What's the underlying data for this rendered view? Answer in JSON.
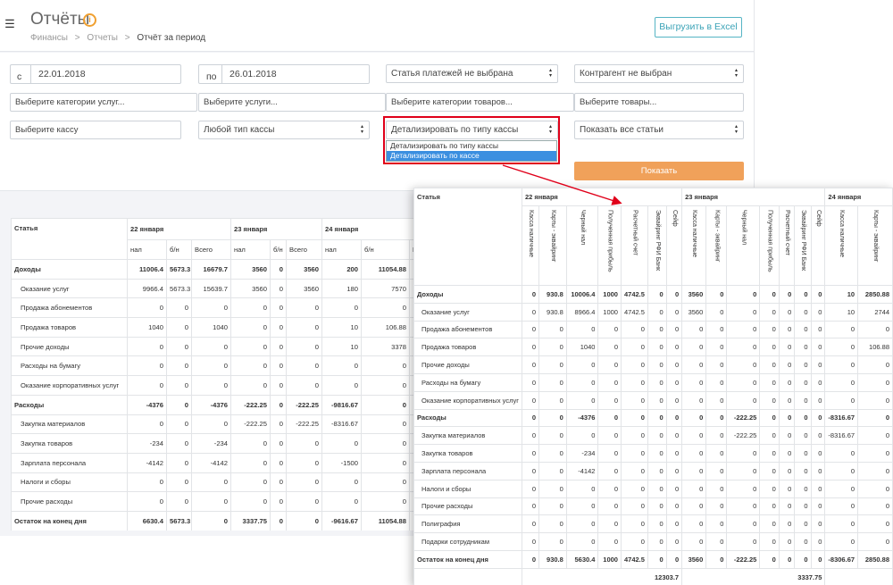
{
  "header": {
    "title": "Отчёты",
    "info_icon": "i",
    "breadcrumb": [
      "Финансы",
      ">",
      "Отчеты",
      ">",
      "Отчёт за период"
    ],
    "export_label": "Выгрузить в Excel"
  },
  "filters": {
    "from_label": "с",
    "from_value": "22.01.2018",
    "to_label": "по",
    "to_value": "26.01.2018",
    "payment_item": "Статья платежей не выбрана",
    "counterparty": "Контрагент не выбран",
    "service_categories_placeholder": "Выберите категории услуг...",
    "services_placeholder": "Выберите услуги...",
    "product_categories_placeholder": "Выберите категории товаров...",
    "products_placeholder": "Выберите товары...",
    "cashbox_placeholder": "Выберите кассу",
    "cashbox_type": "Любой тип кассы",
    "detail_mode": "Детализировать по типу кассы",
    "detail_options": [
      "Детализировать по типу кассы",
      "Детализировать по кассе"
    ],
    "show_items": "Показать все статьи",
    "show_button": "Показать"
  },
  "report_by_type": {
    "item_header": "Статья",
    "dates": [
      "22 января",
      "23 января",
      "24 января"
    ],
    "subcols": [
      "нал",
      "б/н",
      "Всего"
    ],
    "rows": [
      {
        "name": "Доходы",
        "bold": true,
        "values": [
          "11006.4",
          "5673.3",
          "16679.7",
          "3560",
          "0",
          "3560",
          "200",
          "11054.88",
          "11"
        ]
      },
      {
        "name": "Оказание услуг",
        "values": [
          "9966.4",
          "5673.3",
          "15639.7",
          "3560",
          "0",
          "3560",
          "180",
          "7570",
          ""
        ]
      },
      {
        "name": "Продажа абонементов",
        "values": [
          "0",
          "0",
          "0",
          "0",
          "0",
          "0",
          "0",
          "0",
          ""
        ]
      },
      {
        "name": "Продажа товаров",
        "values": [
          "1040",
          "0",
          "1040",
          "0",
          "0",
          "0",
          "10",
          "106.88",
          ""
        ]
      },
      {
        "name": "Прочие доходы",
        "values": [
          "0",
          "0",
          "0",
          "0",
          "0",
          "0",
          "10",
          "3378",
          ""
        ]
      },
      {
        "name": "Расходы на бумагу",
        "values": [
          "0",
          "0",
          "0",
          "0",
          "0",
          "0",
          "0",
          "0",
          ""
        ]
      },
      {
        "name": "Оказание корпоративных услуг",
        "values": [
          "0",
          "0",
          "0",
          "0",
          "0",
          "0",
          "0",
          "0",
          ""
        ]
      },
      {
        "name": "Расходы",
        "bold": true,
        "values": [
          "-4376",
          "0",
          "-4376",
          "-222.25",
          "0",
          "-222.25",
          "-9816.67",
          "0",
          "-9"
        ]
      },
      {
        "name": "Закупка материалов",
        "values": [
          "0",
          "0",
          "0",
          "-222.25",
          "0",
          "-222.25",
          "-8316.67",
          "0",
          ""
        ]
      },
      {
        "name": "Закупка товаров",
        "values": [
          "-234",
          "0",
          "-234",
          "0",
          "0",
          "0",
          "0",
          "0",
          ""
        ]
      },
      {
        "name": "Зарплата персонала",
        "values": [
          "-4142",
          "0",
          "-4142",
          "0",
          "0",
          "0",
          "-1500",
          "0",
          ""
        ]
      },
      {
        "name": "Налоги и сборы",
        "values": [
          "0",
          "0",
          "0",
          "0",
          "0",
          "0",
          "0",
          "0",
          ""
        ]
      },
      {
        "name": "Прочие расходы",
        "values": [
          "0",
          "0",
          "0",
          "0",
          "0",
          "0",
          "0",
          "0",
          ""
        ]
      },
      {
        "name": "Остаток на конец дня",
        "bold": true,
        "values": [
          "6630.4",
          "5673.3",
          "0",
          "3337.75",
          "0",
          "0",
          "-9616.67",
          "11054.88",
          ""
        ]
      }
    ],
    "totals": [
      "12303.7",
      "3337.75",
      "1"
    ]
  },
  "report_by_cashbox": {
    "item_header": "Статья",
    "dates": [
      "22 января",
      "23 января",
      "24 января"
    ],
    "cols_22": [
      "Касса наличные",
      "Карты - эквайринг",
      "Черный нал",
      "Полученная прибыль",
      "Расчетный счет",
      "Эквайринг РФИ Банк",
      "Сейф"
    ],
    "cols_23": [
      "Касса наличные",
      "Карты - эквайринг",
      "Черный нал",
      "Полученная прибыль",
      "Расчетный счет",
      "Эквайринг РФИ Банк",
      "Сейф"
    ],
    "cols_24": [
      "Касса наличные",
      "Карты - эквайринг"
    ],
    "rows": [
      {
        "name": "Доходы",
        "bold": true,
        "values": [
          "0",
          "930.8",
          "10006.4",
          "1000",
          "4742.5",
          "0",
          "0",
          "3560",
          "0",
          "0",
          "0",
          "0",
          "0",
          "0",
          "10",
          "2850.88"
        ]
      },
      {
        "name": "Оказание услуг",
        "values": [
          "0",
          "930.8",
          "8966.4",
          "1000",
          "4742.5",
          "0",
          "0",
          "3560",
          "0",
          "0",
          "0",
          "0",
          "0",
          "0",
          "10",
          "2744"
        ]
      },
      {
        "name": "Продажа абонементов",
        "values": [
          "0",
          "0",
          "0",
          "0",
          "0",
          "0",
          "0",
          "0",
          "0",
          "0",
          "0",
          "0",
          "0",
          "0",
          "0",
          "0"
        ]
      },
      {
        "name": "Продажа товаров",
        "values": [
          "0",
          "0",
          "1040",
          "0",
          "0",
          "0",
          "0",
          "0",
          "0",
          "0",
          "0",
          "0",
          "0",
          "0",
          "0",
          "106.88"
        ]
      },
      {
        "name": "Прочие доходы",
        "values": [
          "0",
          "0",
          "0",
          "0",
          "0",
          "0",
          "0",
          "0",
          "0",
          "0",
          "0",
          "0",
          "0",
          "0",
          "0",
          "0"
        ]
      },
      {
        "name": "Расходы на бумагу",
        "values": [
          "0",
          "0",
          "0",
          "0",
          "0",
          "0",
          "0",
          "0",
          "0",
          "0",
          "0",
          "0",
          "0",
          "0",
          "0",
          "0"
        ]
      },
      {
        "name": "Оказание корпоративных услуг",
        "values": [
          "0",
          "0",
          "0",
          "0",
          "0",
          "0",
          "0",
          "0",
          "0",
          "0",
          "0",
          "0",
          "0",
          "0",
          "0",
          "0"
        ]
      },
      {
        "name": "Расходы",
        "bold": true,
        "values": [
          "0",
          "0",
          "-4376",
          "0",
          "0",
          "0",
          "0",
          "0",
          "0",
          "-222.25",
          "0",
          "0",
          "0",
          "0",
          "-8316.67",
          "0"
        ]
      },
      {
        "name": "Закупка материалов",
        "values": [
          "0",
          "0",
          "0",
          "0",
          "0",
          "0",
          "0",
          "0",
          "0",
          "-222.25",
          "0",
          "0",
          "0",
          "0",
          "-8316.67",
          "0"
        ]
      },
      {
        "name": "Закупка товаров",
        "values": [
          "0",
          "0",
          "-234",
          "0",
          "0",
          "0",
          "0",
          "0",
          "0",
          "0",
          "0",
          "0",
          "0",
          "0",
          "0",
          "0"
        ]
      },
      {
        "name": "Зарплата персонала",
        "values": [
          "0",
          "0",
          "-4142",
          "0",
          "0",
          "0",
          "0",
          "0",
          "0",
          "0",
          "0",
          "0",
          "0",
          "0",
          "0",
          "0"
        ]
      },
      {
        "name": "Налоги и сборы",
        "values": [
          "0",
          "0",
          "0",
          "0",
          "0",
          "0",
          "0",
          "0",
          "0",
          "0",
          "0",
          "0",
          "0",
          "0",
          "0",
          "0"
        ]
      },
      {
        "name": "Прочие расходы",
        "values": [
          "0",
          "0",
          "0",
          "0",
          "0",
          "0",
          "0",
          "0",
          "0",
          "0",
          "0",
          "0",
          "0",
          "0",
          "0",
          "0"
        ]
      },
      {
        "name": "Полиграфия",
        "values": [
          "0",
          "0",
          "0",
          "0",
          "0",
          "0",
          "0",
          "0",
          "0",
          "0",
          "0",
          "0",
          "0",
          "0",
          "0",
          "0"
        ]
      },
      {
        "name": "Подарки сотрудникам",
        "values": [
          "0",
          "0",
          "0",
          "0",
          "0",
          "0",
          "0",
          "0",
          "0",
          "0",
          "0",
          "0",
          "0",
          "0",
          "0",
          "0"
        ]
      },
      {
        "name": "Остаток на конец дня",
        "bold": true,
        "values": [
          "0",
          "930.8",
          "5630.4",
          "1000",
          "4742.5",
          "0",
          "0",
          "3560",
          "0",
          "-222.25",
          "0",
          "0",
          "0",
          "0",
          "-8306.67",
          "2850.88"
        ]
      }
    ],
    "totals": [
      "12303.7",
      "3337.75"
    ]
  },
  "colors": {
    "accent": "#3ba3b7",
    "button": "#f0a15a",
    "highlight": "#e0001a",
    "selected_option": "#3b8fe0"
  }
}
